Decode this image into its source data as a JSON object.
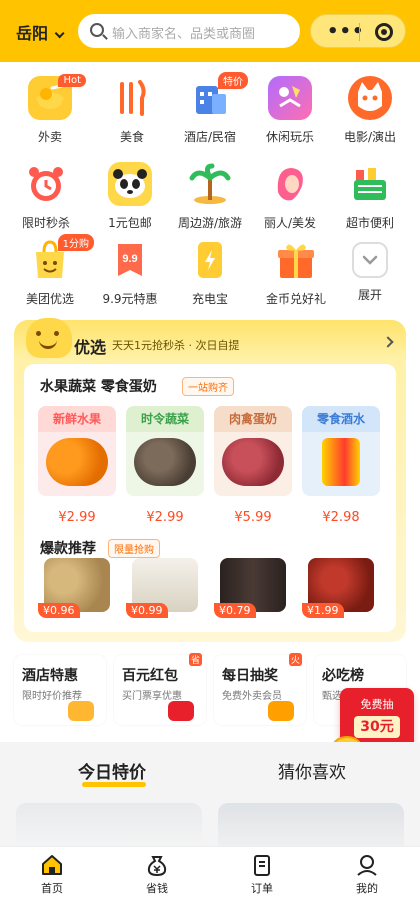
{
  "header": {
    "city": "岳阳",
    "search_placeholder": "输入商家名、品类或商圈",
    "accent": "#ffc300"
  },
  "grid": [
    {
      "label": "外卖",
      "icon": "takeout-icon",
      "tag": "Hot"
    },
    {
      "label": "美食",
      "icon": "fork-knife-icon"
    },
    {
      "label": "酒店/民宿",
      "icon": "hotel-icon",
      "tag": "特价"
    },
    {
      "label": "休闲玩乐",
      "icon": "leisure-icon"
    },
    {
      "label": "电影/演出",
      "icon": "cat-face-icon"
    },
    {
      "label": "限时秒杀",
      "icon": "alarm-clock-icon"
    },
    {
      "label": "1元包邮",
      "icon": "panda-icon"
    },
    {
      "label": "周边游/旅游",
      "icon": "palm-tree-icon"
    },
    {
      "label": "丽人/美发",
      "icon": "woman-hair-icon"
    },
    {
      "label": "超市便利",
      "icon": "basket-icon"
    },
    {
      "label": "美团优选",
      "icon": "shopping-bag-icon",
      "tag": "1分购"
    },
    {
      "label": "9.9元特惠",
      "icon": "price-tag-icon"
    },
    {
      "label": "充电宝",
      "icon": "power-bank-icon"
    },
    {
      "label": "金币兑好礼",
      "icon": "gift-box-icon"
    },
    {
      "label": "展开",
      "icon": "expand-icon"
    }
  ],
  "youxuan": {
    "brand": "优选",
    "slogan": "天天1元抢秒杀 · 次日自提",
    "section1_title": "水果蔬菜 零食蛋奶",
    "section1_pill": "一站购齐",
    "categories": [
      {
        "name": "新鲜水果",
        "price": "¥2.99"
      },
      {
        "name": "时令蔬菜",
        "price": "¥2.99"
      },
      {
        "name": "肉禽蛋奶",
        "price": "¥5.99"
      },
      {
        "name": "零食酒水",
        "price": "¥2.98"
      }
    ],
    "section2_title": "爆款推荐",
    "section2_pill": "限量抢购",
    "hot_items": [
      {
        "price": "¥0.96"
      },
      {
        "price": "¥0.99"
      },
      {
        "price": "¥0.79"
      },
      {
        "price": "¥1.99"
      }
    ]
  },
  "promos": [
    {
      "title": "酒店特惠",
      "sub": "限时好价推荐"
    },
    {
      "title": "百元红包",
      "sub": "买门票享优惠",
      "corner": "省"
    },
    {
      "title": "每日抽奖",
      "sub": "免费外卖会员",
      "corner": "火"
    },
    {
      "title": "必吃榜",
      "sub": "甄选"
    }
  ],
  "coupon": {
    "label": "免费抽",
    "value": "30元"
  },
  "tabs": {
    "today": "今日特价",
    "guess": "猜你喜欢"
  },
  "nav": [
    {
      "label": "首页",
      "icon": "home-icon"
    },
    {
      "label": "省钱",
      "icon": "money-bag-icon"
    },
    {
      "label": "订单",
      "icon": "order-icon"
    },
    {
      "label": "我的",
      "icon": "user-icon"
    }
  ]
}
